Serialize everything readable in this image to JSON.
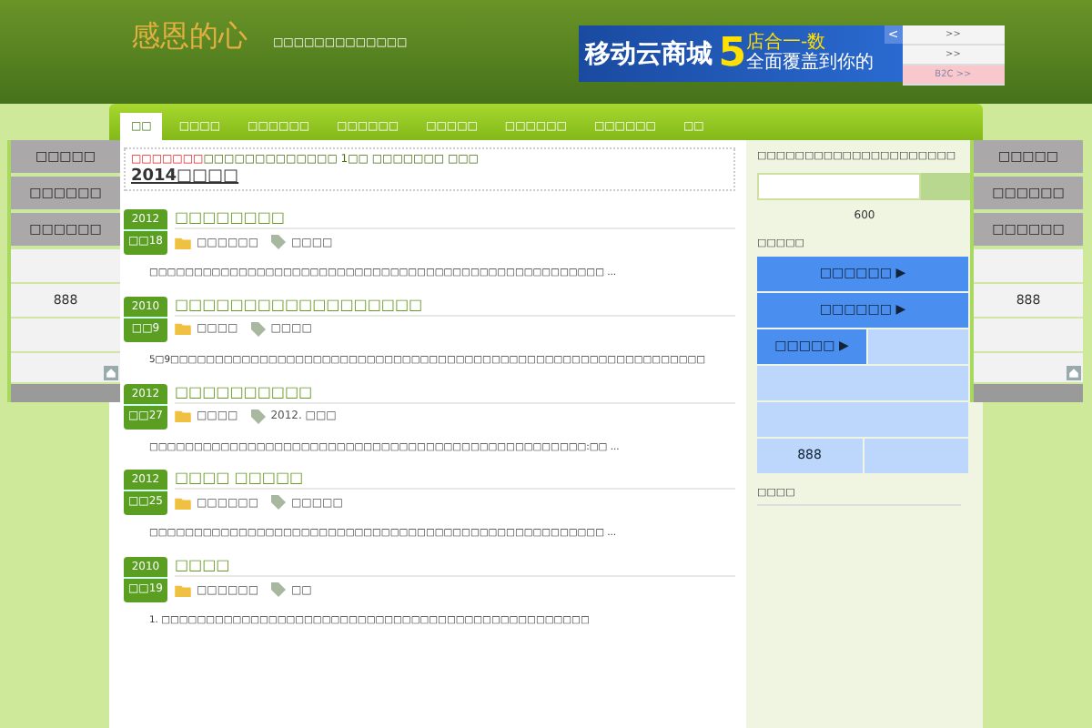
{
  "header": {
    "logo": "感恩的心",
    "tagline": "□□□□□□□□□□□□□",
    "ad": {
      "headline": "移动云商城",
      "number": "5",
      "line1": "店合一-数",
      "line2": "全面覆盖到你的",
      "arrow": "<"
    },
    "ad_links": [
      {
        "label": ">>",
        "highlight": false
      },
      {
        "label": ">>",
        "highlight": false
      },
      {
        "label": "B2C >>",
        "highlight": true
      }
    ]
  },
  "nav": [
    {
      "label": "□□",
      "selected": true
    },
    {
      "label": "□□□□",
      "selected": false
    },
    {
      "label": "□□□□□□",
      "selected": false
    },
    {
      "label": "□□□□□□",
      "selected": false
    },
    {
      "label": "□□□□□",
      "selected": false
    },
    {
      "label": "□□□□□□",
      "selected": false
    },
    {
      "label": "□□□□□□",
      "selected": false
    },
    {
      "label": "□□",
      "selected": false
    }
  ],
  "notice": {
    "alert": "□□□□□□□",
    "text": "□□□□□□□□□□□□□ 1□□ □□□□□□□ □□□",
    "link": "2014□□□□"
  },
  "posts": [
    {
      "year": "2012",
      "day": "□□18",
      "title": "□□□□□□□□",
      "category": "□□□□□□",
      "tags": "□□□□",
      "excerpt": "□□□□□□□□□□□□□□□□□□□□□□□□□□□□□□□□□□□□□□□□□□□□□□□□□□□ ..."
    },
    {
      "year": "2010",
      "day": "□□9",
      "title": "□□□□□□□□□□□□□□□□□□",
      "category": "□□□□",
      "tags": "□□□□",
      "excerpt": "5□9□□□□□□□□□□□□□□□□□□□□□□□□□□□□□□□□□□□□□□□□□□□□□□□□□□□□□□□□□□□□"
    },
    {
      "year": "2012",
      "day": "□□27",
      "title": "□□□□□□□□□□",
      "category": "□□□□",
      "tags": "2012. □□□",
      "excerpt": "□□□□□□□□□□□□□□□□□□□□□□□□□□□□□□□□□□□□□□□□□□□□□□□□□:□□ ..."
    },
    {
      "year": "2012",
      "day": "□□25",
      "title": "□□□□ □□□□□",
      "category": "□□□□□□",
      "tags": "□□□□□",
      "excerpt": "□□□□□□□□□□□□□□□□□□□□□□□□□□□□□□□□□□□□□□□□□□□□□□□□□□□ ..."
    },
    {
      "year": "2010",
      "day": "□□19",
      "title": "□□□□",
      "category": "□□□□□□",
      "tags": "□□",
      "excerpt": "1. □□□□□□□□□□□□□□□□□□□□□□□□□□□□□□□□□□□□□□□□□□□□□□□□"
    }
  ],
  "sidebar": {
    "caption": "□□□□□□□□□□□□□□□□□□□□□",
    "count": "600",
    "menu_title": "□□□□□",
    "menu": [
      {
        "label": "□□□□□□",
        "arrow": "▶"
      },
      {
        "label": "□□□□□□",
        "arrow": "▶"
      },
      {
        "label": "□□□□□",
        "arrow": "▶"
      }
    ],
    "menu_count": "888",
    "section_title": "□□□□"
  },
  "float_left": {
    "buttons": [
      "□□□□□",
      "□□□□□□",
      "□□□□□□"
    ],
    "count": "888"
  },
  "float_right": {
    "buttons": [
      "□□□□□",
      "□□□□□□",
      "□□□□□□"
    ],
    "count": "888"
  }
}
